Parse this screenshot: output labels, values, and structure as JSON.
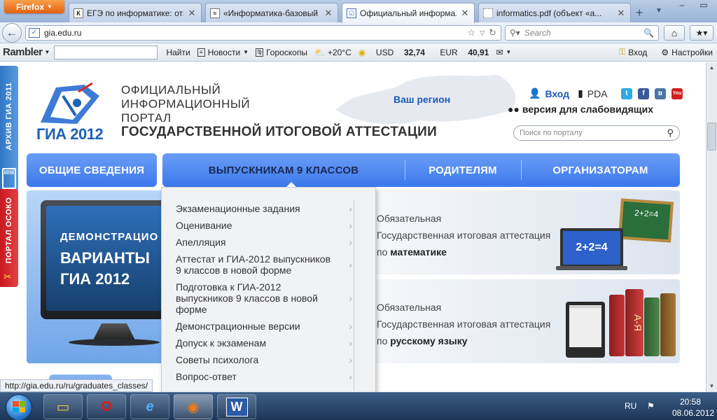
{
  "browser": {
    "menu_button": "Firefox",
    "tabs": [
      {
        "label": "ЕГЭ по информатике: отз...",
        "icon": "К",
        "active": false
      },
      {
        "label": "«Информатика-базовый ...",
        "icon": "≈",
        "active": false
      },
      {
        "label": "Официальный информа...",
        "icon": "☑",
        "active": true
      },
      {
        "label": "informatics.pdf (объект «а...",
        "icon": "",
        "active": false
      }
    ],
    "url": "gia.edu.ru",
    "search_placeholder": "Search"
  },
  "rambler": {
    "logo": "Rambler",
    "find": "Найти",
    "news": "Новости",
    "horoscopes": "Гороскопы",
    "weather": "+20°C",
    "usd_label": "USD",
    "usd_value": "32,74",
    "eur_label": "EUR",
    "eur_value": "40,91",
    "login": "Вход",
    "settings": "Настройки"
  },
  "site": {
    "side_archive": "АРХИВ ГИА 2011",
    "side_portal": "ПОРТАЛ ОСОКО",
    "logo_text": "ГИА 2012",
    "title_line1": "ОФИЦИАЛЬНЫЙ",
    "title_line2": "ИНФОРМАЦИОННЫЙ",
    "title_line3": "ПОРТАЛ",
    "title_line4": "ГОСУДАРСТВЕННОЙ ИТОГОВОЙ АТТЕСТАЦИИ",
    "region": "Ваш регион",
    "login": "Вход",
    "pda": "PDA",
    "vision": "версия для слабовидящих",
    "search_placeholder": "Поиск по порталу",
    "menu": {
      "general": "ОБЩИЕ СВЕДЕНИЯ",
      "grade9": "ВЫПУСКНИКАМ 9 КЛАССОВ",
      "parents": "РОДИТЕЛЯМ",
      "organizers": "ОРГАНИЗАТОРАМ"
    },
    "dropdown": [
      "Экзаменационные задания",
      "Оценивание",
      "Апелляция",
      "Аттестат и ГИА-2012 выпускников 9 классов в новой форме",
      "Подготовка к ГИА-2012 выпускников 9 классов в новой форме",
      "Демонстрационные версии",
      "Допуск к экзаменам",
      "Советы психолога",
      "Вопрос-ответ"
    ],
    "banner_left": {
      "line1": "ДЕМОНСТРАЦИО",
      "line2": "ВАРИАНТЫ",
      "line3": "ГИА 2012"
    },
    "banner_math": {
      "line1": "Обязательная",
      "line2": "Государственная итоговая аттестация",
      "pre": "по",
      "subject": "математике",
      "board": "2+2=4",
      "screen": "2+2=4"
    },
    "banner_rus": {
      "line1": "Обязательная",
      "line2": "Государственная итоговая аттестация",
      "pre": "по",
      "subject": "русскому языку",
      "book": "А-Я"
    }
  },
  "status_url": "http://gia.edu.ru/ru/graduates_classes/",
  "taskbar": {
    "lang": "RU",
    "time": "20:58",
    "date": "08.06.2012"
  }
}
